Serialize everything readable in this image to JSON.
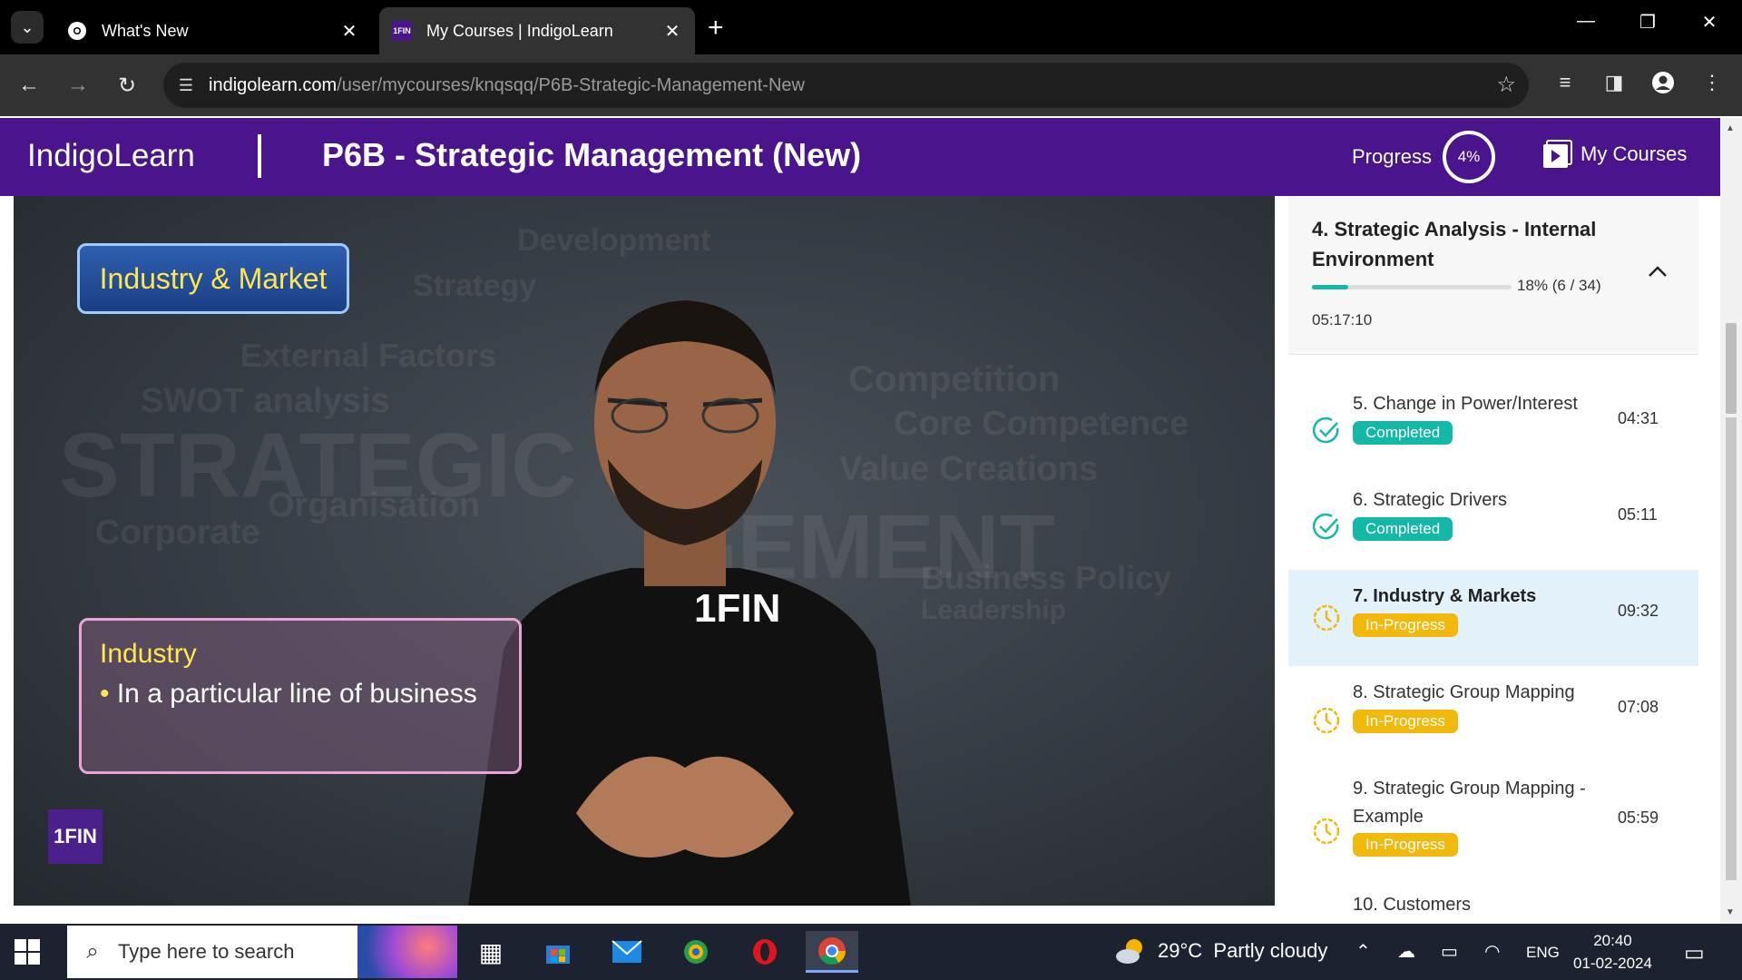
{
  "browser": {
    "tabs": [
      {
        "title": "What's New",
        "icon": "chrome-icon",
        "active": false
      },
      {
        "title": "My Courses | IndigoLearn",
        "icon": "1fin-favicon",
        "favicon_text": "1FIN",
        "active": true
      }
    ],
    "url_domain": "indigolearn.com",
    "url_path": "/user/mycourses/knqsqq/P6B-Strategic-Management-New"
  },
  "header": {
    "brand": "IndigoLearn",
    "course_title": "P6B - Strategic Management (New)",
    "progress_label": "Progress",
    "progress_value": "4%",
    "my_courses": "My Courses",
    "colors": {
      "header_bg": "#4a148c"
    }
  },
  "video": {
    "overlay_title": "Industry & Market",
    "overlay_heading": "Industry",
    "overlay_bullet": "In a particular line of business",
    "logo_text": "1FIN",
    "shirt_text": "1FIN"
  },
  "sidebar": {
    "section": {
      "title": "4. Strategic Analysis - Internal Environment",
      "progress_text": "18% (6 / 34)",
      "progress_fraction": 0.18,
      "duration": "05:17:10"
    },
    "lessons": [
      {
        "title": "5. Change in Power/Interest",
        "status": "Completed",
        "duration": "04:31"
      },
      {
        "title": "6. Strategic Drivers",
        "status": "Completed",
        "duration": "05:11"
      },
      {
        "title": "7. Industry & Markets",
        "status": "In-Progress",
        "duration": "09:32"
      },
      {
        "title": "8. Strategic Group Mapping",
        "status": "In-Progress",
        "duration": "07:08"
      },
      {
        "title": "9. Strategic Group Mapping - Example",
        "status": "In-Progress",
        "duration": "05:59"
      },
      {
        "title": "10. Customers",
        "status": "",
        "duration": ""
      }
    ],
    "colors": {
      "completed": "#14b8a6",
      "in_progress": "#f0b90b",
      "current_bg": "#e3f1fb"
    }
  },
  "taskbar": {
    "search_placeholder": "Type here to search",
    "weather_temp": "29°C",
    "weather_desc": "Partly cloudy",
    "language": "ENG",
    "time": "20:40",
    "date": "01-02-2024"
  }
}
